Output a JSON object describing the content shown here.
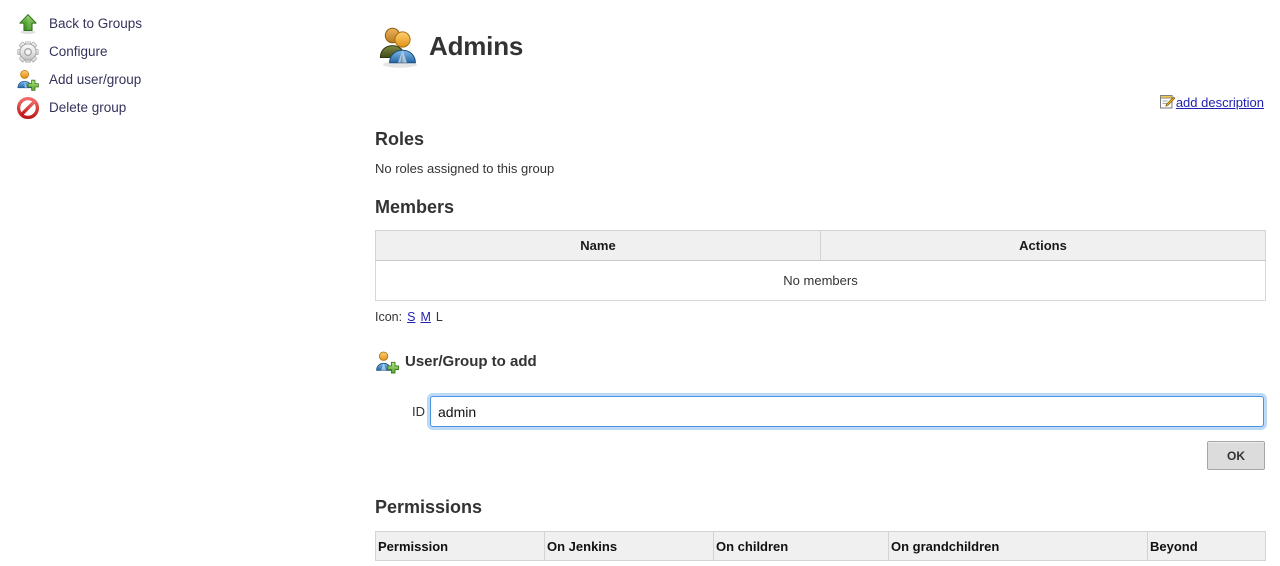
{
  "sidebar": {
    "items": [
      {
        "label": "Back to Groups",
        "icon": "up-arrow-icon"
      },
      {
        "label": "Configure",
        "icon": "gear-icon"
      },
      {
        "label": "Add user/group",
        "icon": "add-user-icon"
      },
      {
        "label": "Delete group",
        "icon": "delete-icon"
      }
    ]
  },
  "header": {
    "title": "Admins",
    "icon": "group-people-icon"
  },
  "description": {
    "link_label": "add description",
    "icon": "edit-description-icon"
  },
  "roles": {
    "heading": "Roles",
    "empty_text": "No roles assigned to this group"
  },
  "members": {
    "heading": "Members",
    "columns": [
      "Name",
      "Actions"
    ],
    "empty_text": "No members",
    "icon_size": {
      "label": "Icon:",
      "options": [
        {
          "label": "S",
          "selected": false
        },
        {
          "label": "M",
          "selected": false
        },
        {
          "label": "L",
          "selected": true
        }
      ]
    }
  },
  "add_user_group": {
    "heading": "User/Group to add",
    "icon": "add-user-icon",
    "id_label": "ID",
    "id_value": "admin",
    "id_placeholder": "",
    "ok_label": "OK"
  },
  "permissions": {
    "heading": "Permissions",
    "columns": [
      "Permission",
      "On Jenkins",
      "On children",
      "On grandchildren",
      "Beyond"
    ]
  },
  "colors": {
    "link": "#1f1fb4",
    "sidebar_link": "#33335c",
    "table_header_bg": "#f0f0f0",
    "focus_ring": "#6aadf0",
    "accent_green": "#5aab3a",
    "accent_red": "#d02a2a"
  }
}
